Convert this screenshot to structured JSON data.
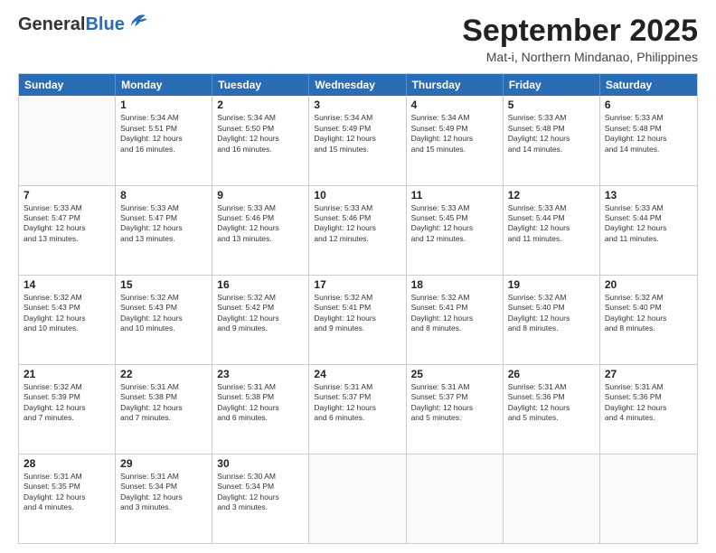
{
  "logo": {
    "general": "General",
    "blue": "Blue"
  },
  "title": "September 2025",
  "location": "Mat-i, Northern Mindanao, Philippines",
  "header_days": [
    "Sunday",
    "Monday",
    "Tuesday",
    "Wednesday",
    "Thursday",
    "Friday",
    "Saturday"
  ],
  "weeks": [
    [
      {
        "day": "",
        "info": ""
      },
      {
        "day": "1",
        "info": "Sunrise: 5:34 AM\nSunset: 5:51 PM\nDaylight: 12 hours\nand 16 minutes."
      },
      {
        "day": "2",
        "info": "Sunrise: 5:34 AM\nSunset: 5:50 PM\nDaylight: 12 hours\nand 16 minutes."
      },
      {
        "day": "3",
        "info": "Sunrise: 5:34 AM\nSunset: 5:49 PM\nDaylight: 12 hours\nand 15 minutes."
      },
      {
        "day": "4",
        "info": "Sunrise: 5:34 AM\nSunset: 5:49 PM\nDaylight: 12 hours\nand 15 minutes."
      },
      {
        "day": "5",
        "info": "Sunrise: 5:33 AM\nSunset: 5:48 PM\nDaylight: 12 hours\nand 14 minutes."
      },
      {
        "day": "6",
        "info": "Sunrise: 5:33 AM\nSunset: 5:48 PM\nDaylight: 12 hours\nand 14 minutes."
      }
    ],
    [
      {
        "day": "7",
        "info": "Sunrise: 5:33 AM\nSunset: 5:47 PM\nDaylight: 12 hours\nand 13 minutes."
      },
      {
        "day": "8",
        "info": "Sunrise: 5:33 AM\nSunset: 5:47 PM\nDaylight: 12 hours\nand 13 minutes."
      },
      {
        "day": "9",
        "info": "Sunrise: 5:33 AM\nSunset: 5:46 PM\nDaylight: 12 hours\nand 13 minutes."
      },
      {
        "day": "10",
        "info": "Sunrise: 5:33 AM\nSunset: 5:46 PM\nDaylight: 12 hours\nand 12 minutes."
      },
      {
        "day": "11",
        "info": "Sunrise: 5:33 AM\nSunset: 5:45 PM\nDaylight: 12 hours\nand 12 minutes."
      },
      {
        "day": "12",
        "info": "Sunrise: 5:33 AM\nSunset: 5:44 PM\nDaylight: 12 hours\nand 11 minutes."
      },
      {
        "day": "13",
        "info": "Sunrise: 5:33 AM\nSunset: 5:44 PM\nDaylight: 12 hours\nand 11 minutes."
      }
    ],
    [
      {
        "day": "14",
        "info": "Sunrise: 5:32 AM\nSunset: 5:43 PM\nDaylight: 12 hours\nand 10 minutes."
      },
      {
        "day": "15",
        "info": "Sunrise: 5:32 AM\nSunset: 5:43 PM\nDaylight: 12 hours\nand 10 minutes."
      },
      {
        "day": "16",
        "info": "Sunrise: 5:32 AM\nSunset: 5:42 PM\nDaylight: 12 hours\nand 9 minutes."
      },
      {
        "day": "17",
        "info": "Sunrise: 5:32 AM\nSunset: 5:41 PM\nDaylight: 12 hours\nand 9 minutes."
      },
      {
        "day": "18",
        "info": "Sunrise: 5:32 AM\nSunset: 5:41 PM\nDaylight: 12 hours\nand 8 minutes."
      },
      {
        "day": "19",
        "info": "Sunrise: 5:32 AM\nSunset: 5:40 PM\nDaylight: 12 hours\nand 8 minutes."
      },
      {
        "day": "20",
        "info": "Sunrise: 5:32 AM\nSunset: 5:40 PM\nDaylight: 12 hours\nand 8 minutes."
      }
    ],
    [
      {
        "day": "21",
        "info": "Sunrise: 5:32 AM\nSunset: 5:39 PM\nDaylight: 12 hours\nand 7 minutes."
      },
      {
        "day": "22",
        "info": "Sunrise: 5:31 AM\nSunset: 5:38 PM\nDaylight: 12 hours\nand 7 minutes."
      },
      {
        "day": "23",
        "info": "Sunrise: 5:31 AM\nSunset: 5:38 PM\nDaylight: 12 hours\nand 6 minutes."
      },
      {
        "day": "24",
        "info": "Sunrise: 5:31 AM\nSunset: 5:37 PM\nDaylight: 12 hours\nand 6 minutes."
      },
      {
        "day": "25",
        "info": "Sunrise: 5:31 AM\nSunset: 5:37 PM\nDaylight: 12 hours\nand 5 minutes."
      },
      {
        "day": "26",
        "info": "Sunrise: 5:31 AM\nSunset: 5:36 PM\nDaylight: 12 hours\nand 5 minutes."
      },
      {
        "day": "27",
        "info": "Sunrise: 5:31 AM\nSunset: 5:36 PM\nDaylight: 12 hours\nand 4 minutes."
      }
    ],
    [
      {
        "day": "28",
        "info": "Sunrise: 5:31 AM\nSunset: 5:35 PM\nDaylight: 12 hours\nand 4 minutes."
      },
      {
        "day": "29",
        "info": "Sunrise: 5:31 AM\nSunset: 5:34 PM\nDaylight: 12 hours\nand 3 minutes."
      },
      {
        "day": "30",
        "info": "Sunrise: 5:30 AM\nSunset: 5:34 PM\nDaylight: 12 hours\nand 3 minutes."
      },
      {
        "day": "",
        "info": ""
      },
      {
        "day": "",
        "info": ""
      },
      {
        "day": "",
        "info": ""
      },
      {
        "day": "",
        "info": ""
      }
    ]
  ]
}
